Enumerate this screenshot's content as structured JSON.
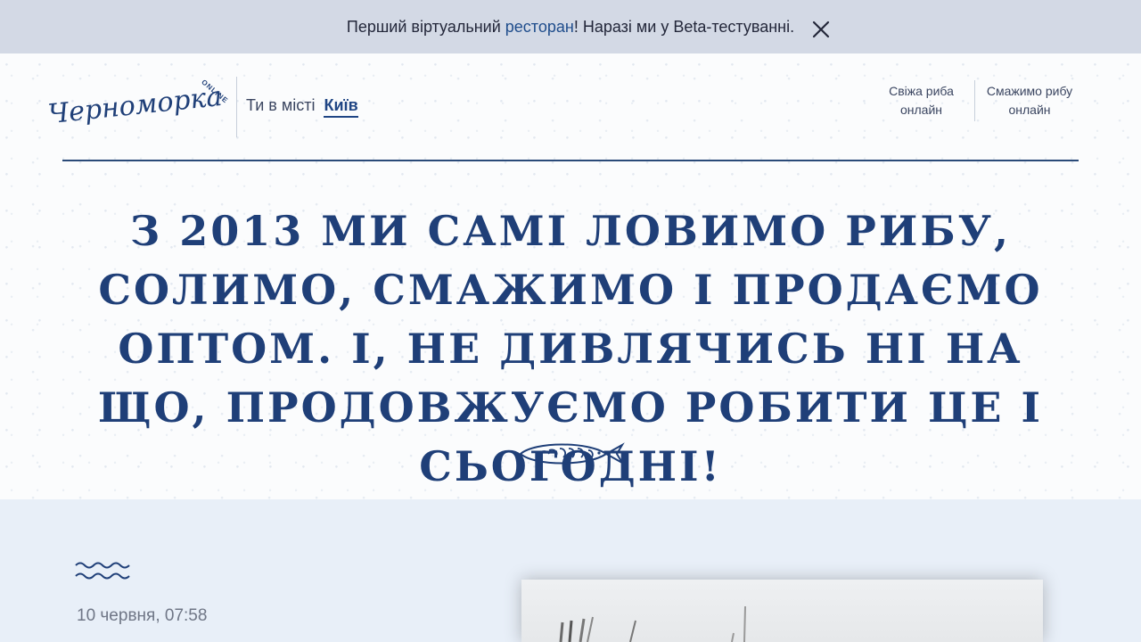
{
  "banner": {
    "text_before": "Перший віртуальний ",
    "link_text": "ресторан",
    "text_after": "! Наразі ми у Beta-тестуванні.",
    "close_icon": "close-icon"
  },
  "header": {
    "logo_text": "Черноморка",
    "logo_badge": "ONLINE",
    "city_prefix": "Ти в місті",
    "city_name": "Київ",
    "nav": [
      {
        "label_line1": "Свіжа риба",
        "label_line2": "онлайн"
      },
      {
        "label_line1": "Смажимо рибу",
        "label_line2": "онлайн"
      }
    ]
  },
  "hero": {
    "heading": "З 2013 ми самі ловимо рибу, солимо, смажимо і продаємо оптом. І, не дивлячись ні на що, продовжуємо робити це і сьогодні!",
    "fish_icon": "fish-icon"
  },
  "post": {
    "waves_icon": "waves-icon",
    "date": "10 червня, 07:58"
  },
  "colors": {
    "brand_blue": "#1f3f78",
    "banner_bg": "#d3d9e5",
    "lower_bg": "#e8eff8"
  }
}
